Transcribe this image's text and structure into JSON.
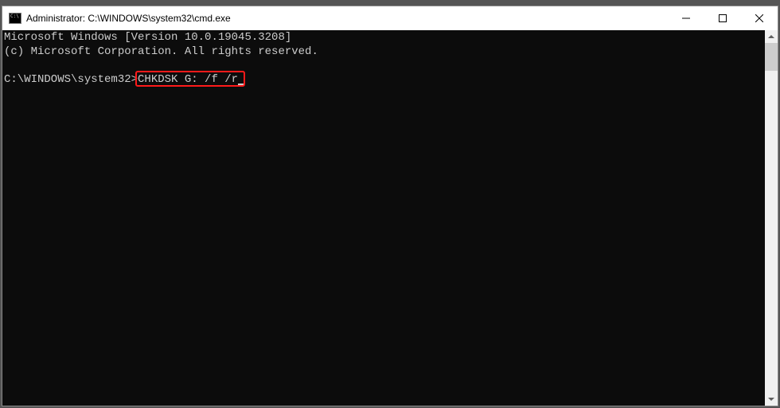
{
  "titlebar": {
    "title": "Administrator: C:\\WINDOWS\\system32\\cmd.exe"
  },
  "console": {
    "line1": "Microsoft Windows [Version 10.0.19045.3208]",
    "line2": "(c) Microsoft Corporation. All rights reserved.",
    "blank": "",
    "prompt": "C:\\WINDOWS\\system32>",
    "command": "CHKDSK G: /f /r"
  },
  "highlight": {
    "target": "command"
  }
}
